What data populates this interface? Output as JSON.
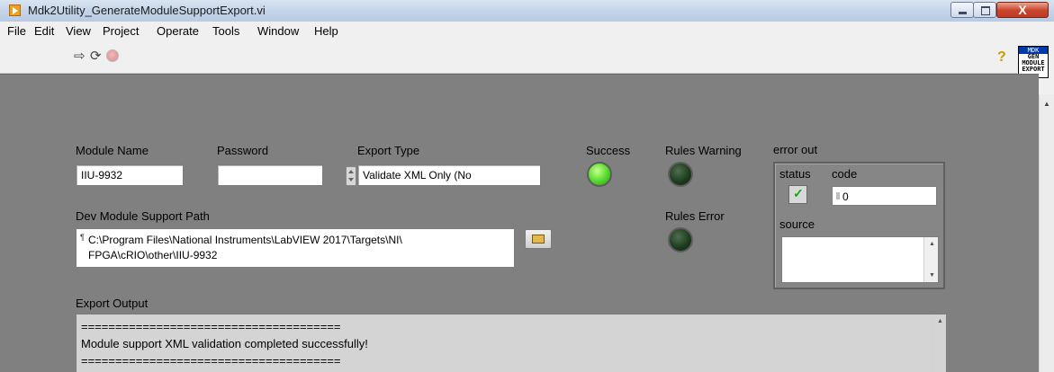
{
  "window": {
    "title": "Mdk2Utility_GenerateModuleSupportExport.vi",
    "close_glyph": "X"
  },
  "menu": [
    "File",
    "Edit",
    "View",
    "Project",
    "Operate",
    "Tools",
    "Window",
    "Help"
  ],
  "toolbar": {
    "run_icon": "⇨",
    "run_continuous_icon": "⟳",
    "help_icon": "?"
  },
  "vi_icon": {
    "top": "MDK",
    "lines": [
      "GEN",
      "MODULE",
      "EXPORT"
    ]
  },
  "controls": {
    "module_name": {
      "label": "Module Name",
      "value": "IIU-9932"
    },
    "password": {
      "label": "Password",
      "value": ""
    },
    "export_type": {
      "label": "Export Type",
      "value": "Validate XML Only (No"
    },
    "dev_path": {
      "label": "Dev Module Support Path",
      "line1": "C:\\Program Files\\National Instruments\\LabVIEW 2017\\Targets\\NI\\",
      "line2": "FPGA\\cRIO\\other\\IIU-9932"
    }
  },
  "indicators": {
    "success": {
      "label": "Success",
      "state": "on"
    },
    "rules_warning": {
      "label": "Rules Warning",
      "state": "off"
    },
    "rules_error": {
      "label": "Rules Error",
      "state": "off"
    },
    "error_out": {
      "label": "error out",
      "status_label": "status",
      "status_glyph": "✓",
      "code_label": "code",
      "code_value": "0",
      "source_label": "source",
      "source_value": ""
    },
    "export_output": {
      "label": "Export Output",
      "lines": [
        "======================================",
        "Module support XML validation completed successfully!",
        "======================================"
      ]
    }
  },
  "colors": {
    "panel_bg": "#808080",
    "led_on": "#52d82b",
    "led_off": "#1b3a1b"
  }
}
